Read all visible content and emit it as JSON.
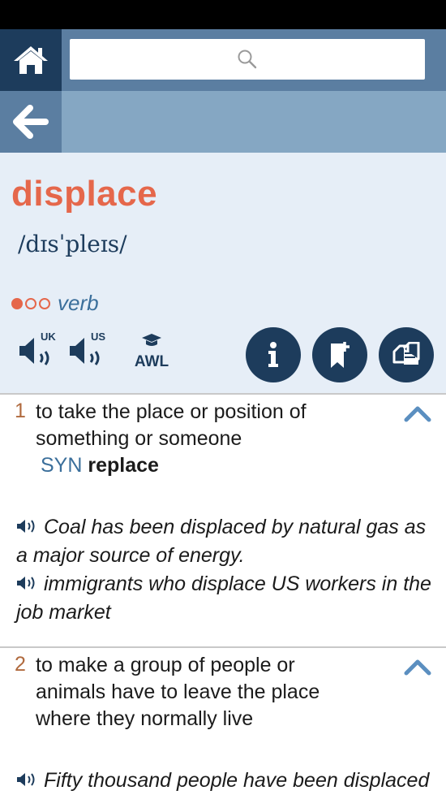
{
  "search": {
    "placeholder": ""
  },
  "entry": {
    "headword": "displace",
    "pronunciation": "/dɪsˈpleɪs/",
    "frequency_level": 1,
    "part_of_speech": "verb",
    "audio": {
      "uk_label": "UK",
      "us_label": "US"
    },
    "awl_label": "AWL"
  },
  "senses": [
    {
      "number": "1",
      "definition_line1": "to take the place or position of",
      "definition_line2": "something or someone",
      "syn_label": "SYN",
      "syn_word": "replace",
      "examples": [
        {
          "line1": "Coal has been displaced by natural gas as",
          "line2": "a major source of energy."
        },
        {
          "line1": "immigrants who displace US workers in the",
          "line2": "job market"
        }
      ]
    },
    {
      "number": "2",
      "definition_line1": "to make a group of people or",
      "definition_line2": "animals have to leave the place",
      "definition_line3": "where they normally live",
      "examples": [
        {
          "line1": "Fifty thousand people have been displaced"
        }
      ]
    }
  ],
  "colors": {
    "headword": "#e5674b",
    "navy": "#1d3c5c",
    "panel": "#e6eef7"
  }
}
